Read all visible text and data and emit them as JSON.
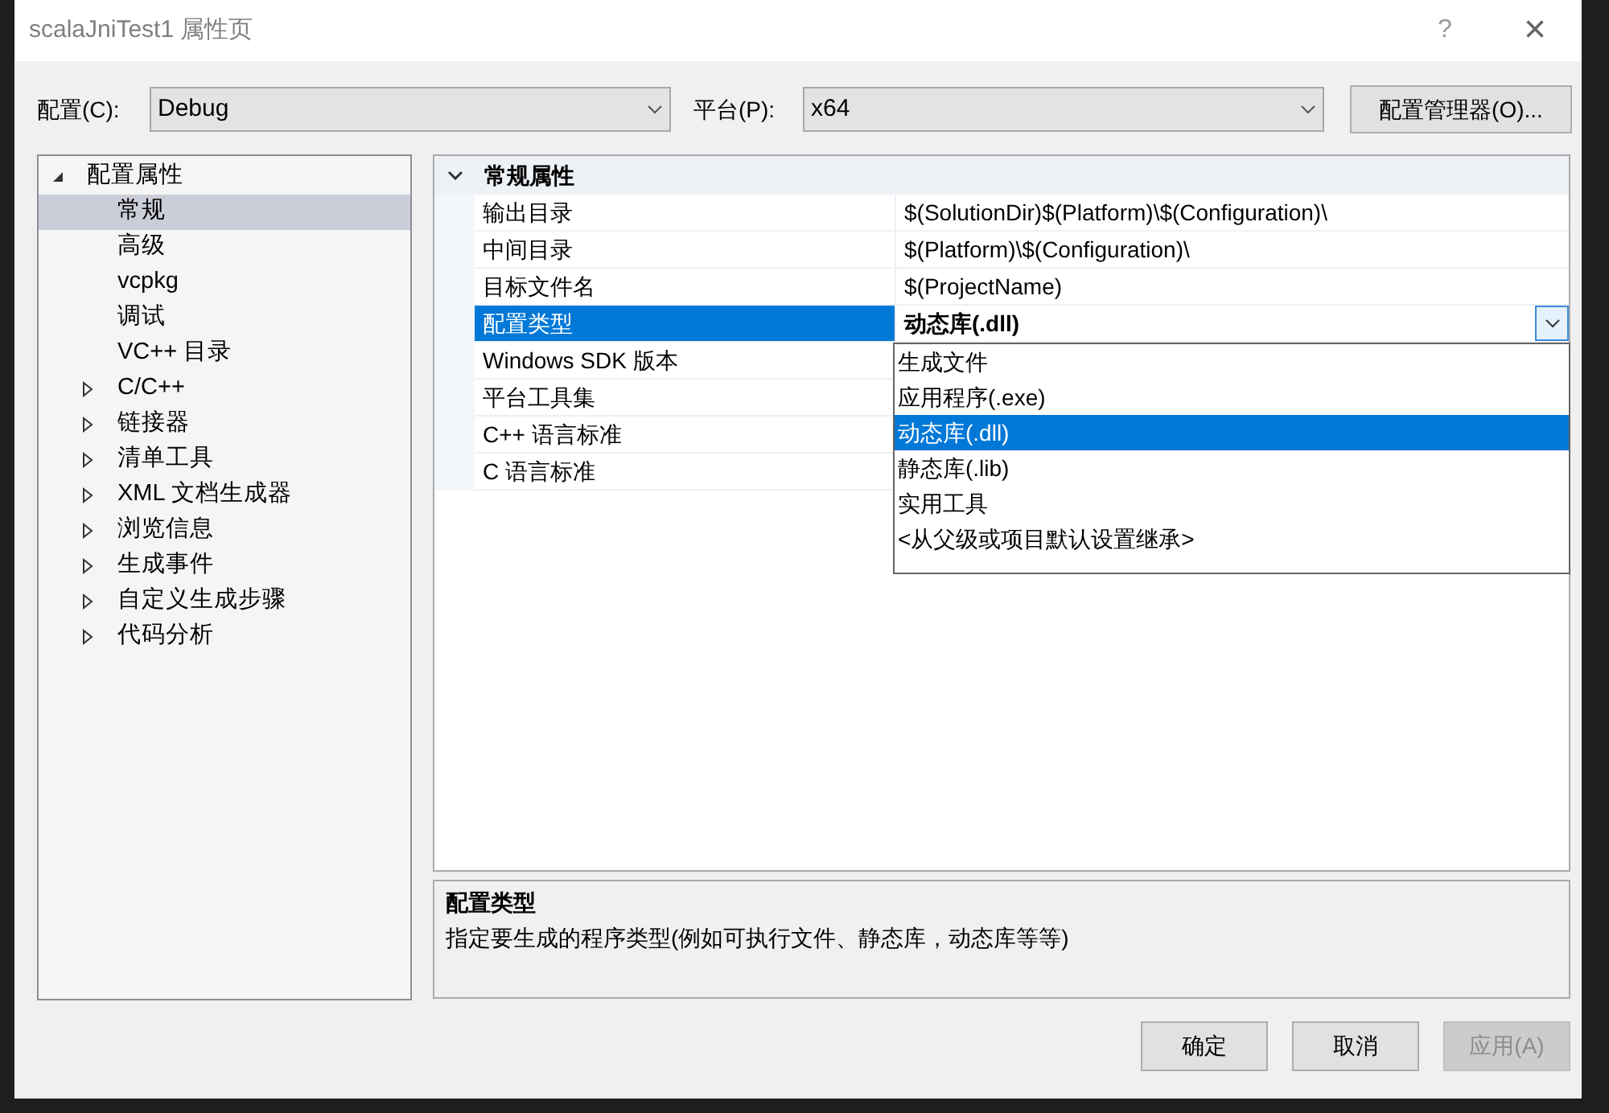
{
  "window": {
    "title": "scalaJniTest1 属性页",
    "help": "?",
    "close": "×"
  },
  "config": {
    "label": "配置(C):",
    "value": "Debug"
  },
  "platform": {
    "label": "平台(P):",
    "value": "x64"
  },
  "config_manager_button": "配置管理器(O)...",
  "tree": [
    {
      "label": "配置属性",
      "expanded": true,
      "selected": false,
      "children": [
        {
          "label": "常规",
          "selected": true
        },
        {
          "label": "高级",
          "selected": false
        },
        {
          "label": "vcpkg",
          "selected": false
        },
        {
          "label": "调试",
          "selected": false
        },
        {
          "label": "VC++ 目录",
          "selected": false
        },
        {
          "label": "C/C++",
          "expanded": false,
          "selected": false
        },
        {
          "label": "链接器",
          "expanded": false,
          "selected": false
        },
        {
          "label": "清单工具",
          "expanded": false,
          "selected": false
        },
        {
          "label": "XML 文档生成器",
          "expanded": false,
          "selected": false
        },
        {
          "label": "浏览信息",
          "expanded": false,
          "selected": false
        },
        {
          "label": "生成事件",
          "expanded": false,
          "selected": false
        },
        {
          "label": "自定义生成步骤",
          "expanded": false,
          "selected": false
        },
        {
          "label": "代码分析",
          "expanded": false,
          "selected": false
        }
      ]
    }
  ],
  "grid": {
    "section": {
      "label": "常规属性",
      "expanded": true
    },
    "rows": [
      {
        "name": "输出目录",
        "value": "$(SolutionDir)$(Platform)\\$(Configuration)\\",
        "selected": false
      },
      {
        "name": "中间目录",
        "value": "$(Platform)\\$(Configuration)\\",
        "selected": false
      },
      {
        "name": "目标文件名",
        "value": "$(ProjectName)",
        "selected": false
      },
      {
        "name": "配置类型",
        "value": "动态库(.dll)",
        "selected": true
      },
      {
        "name": "Windows SDK 版本",
        "selected": false
      },
      {
        "name": "平台工具集",
        "selected": false
      },
      {
        "name": "C++ 语言标准",
        "selected": false
      },
      {
        "name": "C 语言标准",
        "selected": false
      }
    ]
  },
  "dropdown": {
    "options": [
      {
        "label": "生成文件",
        "selected": false
      },
      {
        "label": "应用程序(.exe)",
        "selected": false
      },
      {
        "label": "动态库(.dll)",
        "selected": true
      },
      {
        "label": "静态库(.lib)",
        "selected": false
      },
      {
        "label": "实用工具",
        "selected": false
      },
      {
        "label": "<从父级或项目默认设置继承>",
        "selected": false
      }
    ]
  },
  "description": {
    "title": "配置类型",
    "text": "指定要生成的程序类型(例如可执行文件、静态库，动态库等等)"
  },
  "buttons": [
    {
      "label": "确定",
      "disabled": false
    },
    {
      "label": "取消",
      "disabled": false
    },
    {
      "label": "应用(A)",
      "disabled": true
    }
  ]
}
